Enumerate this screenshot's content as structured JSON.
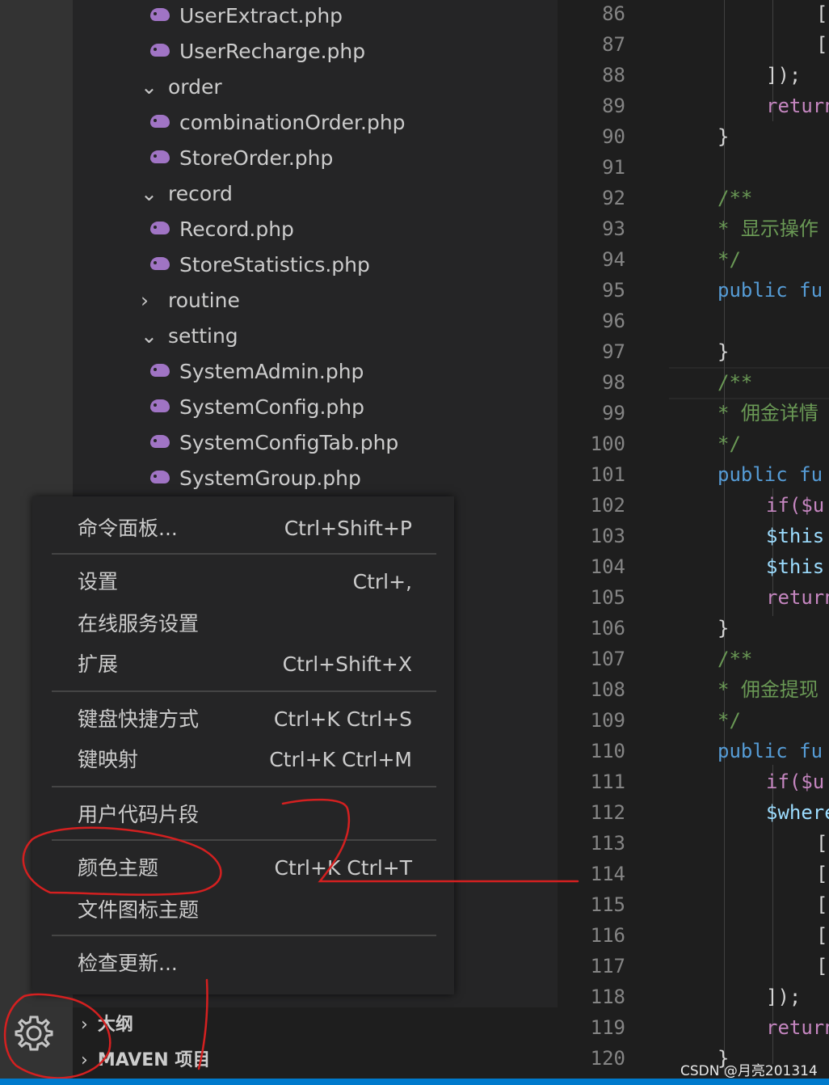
{
  "explorer": {
    "items": [
      {
        "type": "file",
        "label": "UserExtract.php"
      },
      {
        "type": "file",
        "label": "UserRecharge.php"
      },
      {
        "type": "folder-open",
        "label": "order"
      },
      {
        "type": "file",
        "label": "combinationOrder.php"
      },
      {
        "type": "file",
        "label": "StoreOrder.php"
      },
      {
        "type": "folder-open",
        "label": "record"
      },
      {
        "type": "file",
        "label": "Record.php"
      },
      {
        "type": "file",
        "label": "StoreStatistics.php"
      },
      {
        "type": "folder-closed",
        "label": "routine"
      },
      {
        "type": "folder-open",
        "label": "setting"
      },
      {
        "type": "file",
        "label": "SystemAdmin.php"
      },
      {
        "type": "file",
        "label": "SystemConfig.php"
      },
      {
        "type": "file",
        "label": "SystemConfigTab.php"
      },
      {
        "type": "file",
        "label": "SystemGroup.php"
      }
    ],
    "twisty_open": "⌄",
    "twisty_closed": "›",
    "file_icon": "php-elephant-icon"
  },
  "context_menu": {
    "items": [
      {
        "label": "命令面板...",
        "shortcut": "Ctrl+Shift+P"
      },
      {
        "label": "设置",
        "shortcut": "Ctrl+,"
      },
      {
        "label": "在线服务设置",
        "shortcut": ""
      },
      {
        "label": "扩展",
        "shortcut": "Ctrl+Shift+X"
      },
      {
        "label": "键盘快捷方式",
        "shortcut": "Ctrl+K Ctrl+S"
      },
      {
        "label": "键映射",
        "shortcut": "Ctrl+K Ctrl+M"
      },
      {
        "label": "用户代码片段",
        "shortcut": ""
      },
      {
        "label": "颜色主题",
        "shortcut": "Ctrl+K Ctrl+T"
      },
      {
        "label": "文件图标主题",
        "shortcut": ""
      },
      {
        "label": "检查更新...",
        "shortcut": ""
      }
    ]
  },
  "outline_sections": [
    {
      "label": "大纲"
    },
    {
      "label": "MAVEN 项目"
    }
  ],
  "manage_icon": "gear-icon",
  "gutter": {
    "line_numbers": [
      "86",
      "87",
      "88",
      "89",
      "90",
      "91",
      "92",
      "93",
      "94",
      "95",
      "96",
      "97",
      "98",
      "99",
      "100",
      "101",
      "102",
      "103",
      "104",
      "105",
      "106",
      "107",
      "108",
      "109",
      "110",
      "111",
      "112",
      "113",
      "114",
      "115",
      "116",
      "117",
      "118",
      "119",
      "120"
    ]
  },
  "editor": {
    "lines": [
      {
        "text": "[",
        "cls": "c-punct",
        "indent": 3
      },
      {
        "text": "[",
        "cls": "c-punct",
        "indent": 3
      },
      {
        "text": "]);",
        "cls": "c-punct",
        "indent": 2
      },
      {
        "text": "return",
        "cls": "c-ctrl",
        "indent": 2
      },
      {
        "text": "}",
        "cls": "c-punct",
        "indent": 1
      },
      {
        "text": "",
        "cls": "c-punct",
        "indent": 0
      },
      {
        "text": "/**",
        "cls": "c-cmt",
        "indent": 1
      },
      {
        "text": "* 显示操作",
        "cls": "c-cmt",
        "indent": 1
      },
      {
        "text": "*/",
        "cls": "c-cmt",
        "indent": 1
      },
      {
        "text": "public fu",
        "cls": "c-kw",
        "indent": 1
      },
      {
        "text": "",
        "cls": "c-punct",
        "indent": 0
      },
      {
        "text": "}",
        "cls": "c-punct",
        "indent": 1
      },
      {
        "text": "/**",
        "cls": "c-cmt",
        "indent": 1
      },
      {
        "text": "* 佣金详情",
        "cls": "c-cmt",
        "indent": 1
      },
      {
        "text": "*/",
        "cls": "c-cmt",
        "indent": 1
      },
      {
        "text": "public fu",
        "cls": "c-kw",
        "indent": 1
      },
      {
        "text": "if($u",
        "cls": "c-ctrl",
        "indent": 2
      },
      {
        "text": "$this",
        "cls": "c-var",
        "indent": 2
      },
      {
        "text": "$this",
        "cls": "c-var",
        "indent": 2
      },
      {
        "text": "return",
        "cls": "c-ctrl",
        "indent": 2
      },
      {
        "text": "}",
        "cls": "c-punct",
        "indent": 1
      },
      {
        "text": "/**",
        "cls": "c-cmt",
        "indent": 1
      },
      {
        "text": "* 佣金提现",
        "cls": "c-cmt",
        "indent": 1
      },
      {
        "text": "*/",
        "cls": "c-cmt",
        "indent": 1
      },
      {
        "text": "public fu",
        "cls": "c-kw",
        "indent": 1
      },
      {
        "text": "if($u",
        "cls": "c-ctrl",
        "indent": 2
      },
      {
        "text": "$where",
        "cls": "c-var",
        "indent": 2
      },
      {
        "text": "[",
        "cls": "c-punct",
        "indent": 3
      },
      {
        "text": "[",
        "cls": "c-punct",
        "indent": 3
      },
      {
        "text": "[",
        "cls": "c-punct",
        "indent": 3
      },
      {
        "text": "[",
        "cls": "c-punct",
        "indent": 3
      },
      {
        "text": "[",
        "cls": "c-punct",
        "indent": 3
      },
      {
        "text": "]);",
        "cls": "c-punct",
        "indent": 2
      },
      {
        "text": "return",
        "cls": "c-ctrl",
        "indent": 2
      },
      {
        "text": "}",
        "cls": "c-punct",
        "indent": 1
      }
    ]
  },
  "watermark": "CSDN @月亮201314",
  "annotation_number": "2",
  "colors": {
    "background": "#1e1e1e",
    "sidebar": "#252526",
    "activity_bar": "#333333",
    "menu_bg": "#252526",
    "accent": "#007acc",
    "annotation_red": "#d42020"
  }
}
